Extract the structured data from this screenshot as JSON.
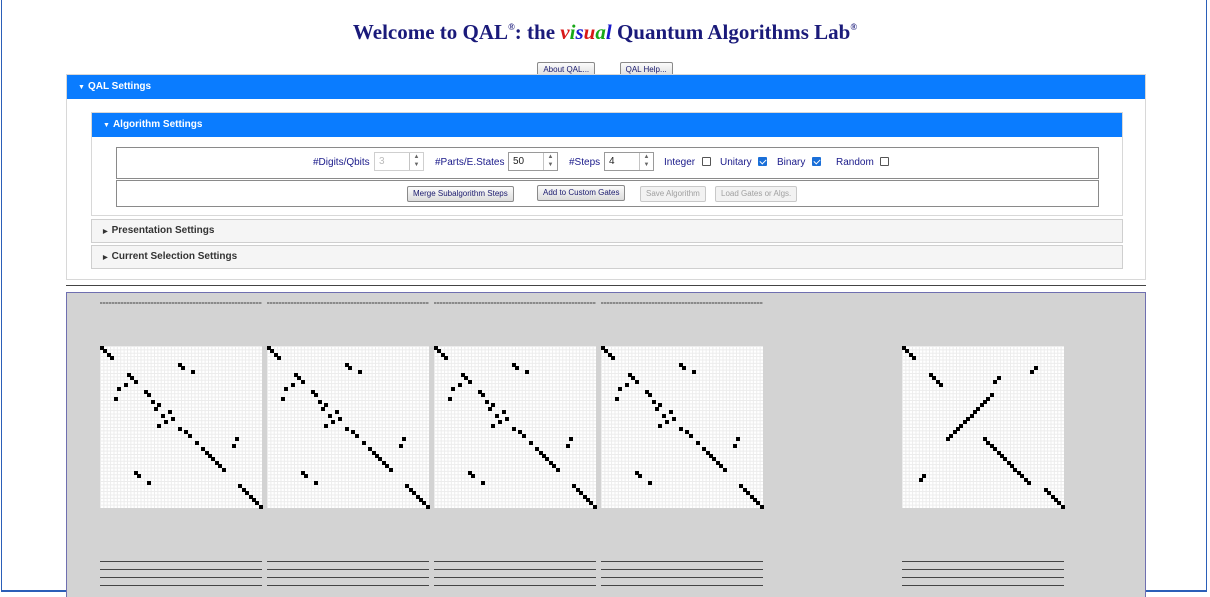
{
  "header": {
    "title_prefix": "Welcome to QAL",
    "title_mid": ": the ",
    "title_visual": "visual",
    "title_suffix": " Quantum Algorithms Lab",
    "reg_mark": "®",
    "visual_colors": [
      "#d81818",
      "#18a818",
      "#1a1acc",
      "#d81818",
      "#18a818",
      "#1a1acc"
    ]
  },
  "top_buttons": {
    "about": "About QAL...",
    "help": "QAL Help..."
  },
  "qal_settings": {
    "label": "QAL Settings",
    "algorithm_settings": {
      "label": "Algorithm Settings",
      "digits_label": "#Digits/Qbits",
      "digits_value": "3",
      "parts_label": "#Parts/E.States",
      "parts_value": "50",
      "steps_label": "#Steps",
      "steps_value": "4",
      "integer_label": "Integer",
      "integer_checked": false,
      "unitary_label": "Unitary",
      "unitary_checked": true,
      "binary_label": "Binary",
      "binary_checked": true,
      "random_label": "Random",
      "random_checked": false,
      "merge_button": "Merge Subalgorithm Steps",
      "add_button": "Add to Custom Gates",
      "save_button": "Save Algorithm",
      "load_button": "Load Gates or Algs."
    },
    "presentation_settings": "Presentation Settings",
    "current_selection_settings": "Current Selection Settings"
  },
  "matrices": {
    "size": 48,
    "step_cells": [
      [
        0,
        0
      ],
      [
        1,
        1
      ],
      [
        2,
        2
      ],
      [
        3,
        3
      ],
      [
        23,
        5
      ],
      [
        24,
        6
      ],
      [
        27,
        7
      ],
      [
        8,
        8
      ],
      [
        9,
        9
      ],
      [
        10,
        10
      ],
      [
        7,
        11
      ],
      [
        5,
        12
      ],
      [
        13,
        13
      ],
      [
        14,
        14
      ],
      [
        4,
        15
      ],
      [
        15,
        16
      ],
      [
        17,
        17
      ],
      [
        16,
        18
      ],
      [
        20,
        19
      ],
      [
        18,
        20
      ],
      [
        21,
        21
      ],
      [
        19,
        22
      ],
      [
        17,
        23
      ],
      [
        23,
        24
      ],
      [
        25,
        25
      ],
      [
        26,
        26
      ],
      [
        40,
        27
      ],
      [
        28,
        28
      ],
      [
        39,
        29
      ],
      [
        30,
        30
      ],
      [
        31,
        31
      ],
      [
        32,
        32
      ],
      [
        33,
        33
      ],
      [
        34,
        34
      ],
      [
        35,
        35
      ],
      [
        36,
        36
      ],
      [
        10,
        37
      ],
      [
        11,
        38
      ],
      [
        14,
        40
      ],
      [
        41,
        41
      ],
      [
        42,
        42
      ],
      [
        43,
        43
      ],
      [
        44,
        44
      ],
      [
        45,
        45
      ],
      [
        46,
        46
      ],
      [
        47,
        47
      ]
    ],
    "result_cells": [
      [
        0,
        0
      ],
      [
        1,
        1
      ],
      [
        2,
        2
      ],
      [
        3,
        3
      ],
      [
        39,
        6
      ],
      [
        38,
        7
      ],
      [
        8,
        8
      ],
      [
        9,
        9
      ],
      [
        10,
        10
      ],
      [
        11,
        11
      ],
      [
        28,
        9
      ],
      [
        27,
        10
      ],
      [
        26,
        14
      ],
      [
        25,
        15
      ],
      [
        24,
        16
      ],
      [
        23,
        17
      ],
      [
        22,
        18
      ],
      [
        21,
        19
      ],
      [
        20,
        20
      ],
      [
        19,
        21
      ],
      [
        18,
        22
      ],
      [
        17,
        23
      ],
      [
        16,
        24
      ],
      [
        15,
        25
      ],
      [
        14,
        26
      ],
      [
        13,
        27
      ],
      [
        24,
        27
      ],
      [
        25,
        28
      ],
      [
        26,
        29
      ],
      [
        27,
        30
      ],
      [
        28,
        31
      ],
      [
        29,
        32
      ],
      [
        30,
        33
      ],
      [
        31,
        34
      ],
      [
        32,
        35
      ],
      [
        33,
        36
      ],
      [
        34,
        37
      ],
      [
        35,
        38
      ],
      [
        36,
        39
      ],
      [
        37,
        40
      ],
      [
        6,
        38
      ],
      [
        5,
        39
      ],
      [
        42,
        42
      ],
      [
        43,
        43
      ],
      [
        44,
        44
      ],
      [
        45,
        45
      ],
      [
        46,
        46
      ],
      [
        47,
        47
      ]
    ]
  }
}
